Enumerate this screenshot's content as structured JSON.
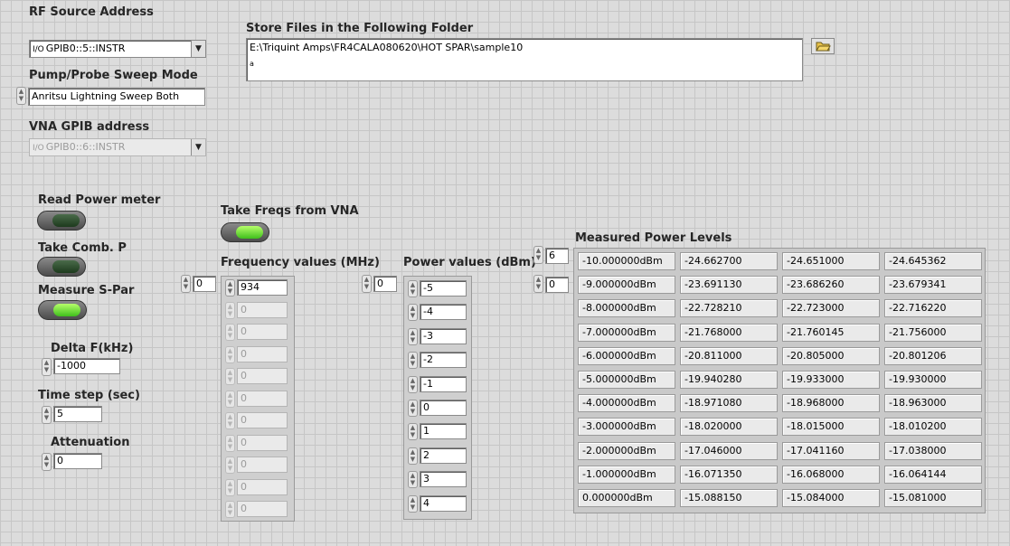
{
  "rf_source": {
    "label": "RF Source Address",
    "value": "GPIB0::5::INSTR",
    "io_glyph": "I/O"
  },
  "sweep_mode": {
    "label": "Pump/Probe Sweep Mode",
    "value": "Anritsu Lightning Sweep Both"
  },
  "vna": {
    "label": "VNA GPIB address",
    "value": "GPIB0::6::INSTR",
    "io_glyph": "I/O"
  },
  "store": {
    "label": "Store Files in the Following Folder",
    "path": "E:\\Triquint Amps\\FR4CALA080620\\HOT SPAR\\sample10",
    "path_glyph": "a"
  },
  "buttons": {
    "read_power": "Read Power meter",
    "take_comb": "Take Comb. P",
    "measure_spar": "Measure S-Par",
    "take_freqs": "Take Freqs from VNA"
  },
  "delta_f": {
    "label": "Delta F(kHz)",
    "value": "-1000"
  },
  "time_step": {
    "label": "Time step (sec)",
    "value": "5"
  },
  "attenuation": {
    "label": "Attenuation",
    "value": "0"
  },
  "freq": {
    "label": "Frequency values (MHz)",
    "index": "0",
    "values": [
      "934",
      "0",
      "0",
      "0",
      "0",
      "0",
      "0",
      "0",
      "0",
      "0",
      "0"
    ]
  },
  "power": {
    "label": "Power values (dBm)",
    "index": "0",
    "values": [
      "-5",
      "-4",
      "-3",
      "-2",
      "-1",
      "0",
      "1",
      "2",
      "3",
      "4"
    ]
  },
  "measured": {
    "label": "Measured Power Levels",
    "row_index": "6",
    "col_index": "0",
    "rows": [
      [
        "-10.000000dBm",
        "-24.662700",
        "-24.651000",
        "-24.645362"
      ],
      [
        "-9.000000dBm",
        "-23.691130",
        "-23.686260",
        "-23.679341"
      ],
      [
        "-8.000000dBm",
        "-22.728210",
        "-22.723000",
        "-22.716220"
      ],
      [
        "-7.000000dBm",
        "-21.768000",
        "-21.760145",
        "-21.756000"
      ],
      [
        "-6.000000dBm",
        "-20.811000",
        "-20.805000",
        "-20.801206"
      ],
      [
        "-5.000000dBm",
        "-19.940280",
        "-19.933000",
        "-19.930000"
      ],
      [
        "-4.000000dBm",
        "-18.971080",
        "-18.968000",
        "-18.963000"
      ],
      [
        "-3.000000dBm",
        "-18.020000",
        "-18.015000",
        "-18.010200"
      ],
      [
        "-2.000000dBm",
        "-17.046000",
        "-17.041160",
        "-17.038000"
      ],
      [
        "-1.000000dBm",
        "-16.071350",
        "-16.068000",
        "-16.064144"
      ],
      [
        "0.000000dBm",
        "-15.088150",
        "-15.084000",
        "-15.081000"
      ]
    ]
  },
  "icons": {
    "spinner": "increment-decrement-icon",
    "dropdown": "chevron-down-icon",
    "folder": "open-folder-icon"
  }
}
